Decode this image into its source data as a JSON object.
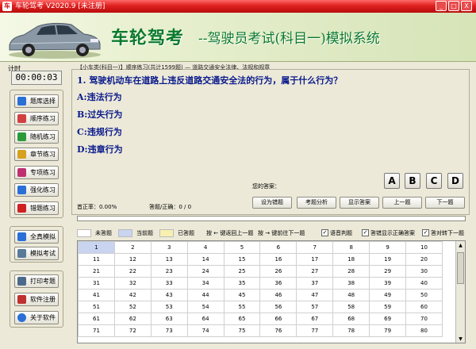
{
  "window": {
    "title": "车轮驾考 V2020.9 [未注册]",
    "controls": [
      "_",
      "□",
      "X"
    ]
  },
  "banner": {
    "brand": "车轮驾考",
    "subtitle": "--驾驶员考试(科目一)模拟系统"
  },
  "timer": {
    "label": "计时",
    "value": "00:00:03"
  },
  "sidebar": {
    "group1": [
      {
        "label": "题库选择",
        "icon": "library-icon",
        "color": "#2a6fd6"
      },
      {
        "label": "顺序练习",
        "icon": "sequence-icon",
        "color": "#d04040"
      },
      {
        "label": "随机练习",
        "icon": "random-icon",
        "color": "#2a9a3a"
      },
      {
        "label": "章节练习",
        "icon": "chapter-icon",
        "color": "#d6a020"
      },
      {
        "label": "专项练习",
        "icon": "special-icon",
        "color": "#c03070"
      },
      {
        "label": "强化练习",
        "icon": "intensive-icon",
        "color": "#2a6fd6"
      },
      {
        "label": "错题练习",
        "icon": "wrong-questions-icon",
        "color": "#d02020"
      }
    ],
    "group2": [
      {
        "label": "全真模拟",
        "icon": "full-simulation-icon",
        "color": "#2a6fd6"
      },
      {
        "label": "模拟考试",
        "icon": "mock-exam-icon",
        "color": "#5a7a9a"
      }
    ],
    "group3": [
      {
        "label": "打印考题",
        "icon": "print-icon",
        "color": "#4a6a8a"
      },
      {
        "label": "软件注册",
        "icon": "register-icon",
        "color": "#c03030"
      },
      {
        "label": "关于软件",
        "icon": "info-icon",
        "color": "#2a6fd6"
      }
    ]
  },
  "breadcrumb": "【小车类(科目一)】顺序练习(共计1599题) — 道路交通安全法律、法规和规章",
  "question": {
    "text": "1. 驾驶机动车在道路上违反道路交通安全法的行为，属于什么行为？",
    "options": [
      "A:违法行为",
      "B:过失行为",
      "C:违规行为",
      "D:违章行为"
    ]
  },
  "answer_buttons": [
    "A",
    "B",
    "C",
    "D"
  ],
  "your_answer_label": "您的答案：",
  "stats": {
    "accuracy": "首正率：0.00%",
    "answered": "答题/正确：0 / 0"
  },
  "actions": [
    "设为错题",
    "考题分析",
    "显示答案",
    "上一题",
    "下一题"
  ],
  "legend": {
    "unanswered": "未答题",
    "current": "当前题",
    "answered": "已答题",
    "prev_hint": "按 ← 键返回上一题",
    "next_hint": "按 → 键前往下一题",
    "voice": "语音判题",
    "show_correct": "答错显示正确答案",
    "auto_next": "答对转下一题"
  },
  "colors": {
    "unanswered": "#ffffff",
    "current": "#c8d4f0",
    "answered": "#f8f0b0"
  },
  "grid_rows": [
    [
      "1",
      "2",
      "3",
      "4",
      "5",
      "6",
      "7",
      "8",
      "9",
      "10"
    ],
    [
      "11",
      "12",
      "13",
      "14",
      "15",
      "16",
      "17",
      "18",
      "19",
      "20"
    ],
    [
      "21",
      "22",
      "23",
      "24",
      "25",
      "26",
      "27",
      "28",
      "29",
      "30"
    ],
    [
      "31",
      "32",
      "33",
      "34",
      "35",
      "36",
      "37",
      "38",
      "39",
      "40"
    ],
    [
      "41",
      "42",
      "43",
      "44",
      "45",
      "46",
      "47",
      "48",
      "49",
      "50"
    ],
    [
      "51",
      "52",
      "53",
      "54",
      "55",
      "56",
      "57",
      "58",
      "59",
      "60"
    ],
    [
      "61",
      "62",
      "63",
      "64",
      "65",
      "66",
      "67",
      "68",
      "69",
      "70"
    ],
    [
      "71",
      "72",
      "73",
      "74",
      "75",
      "76",
      "77",
      "78",
      "79",
      "80"
    ]
  ]
}
